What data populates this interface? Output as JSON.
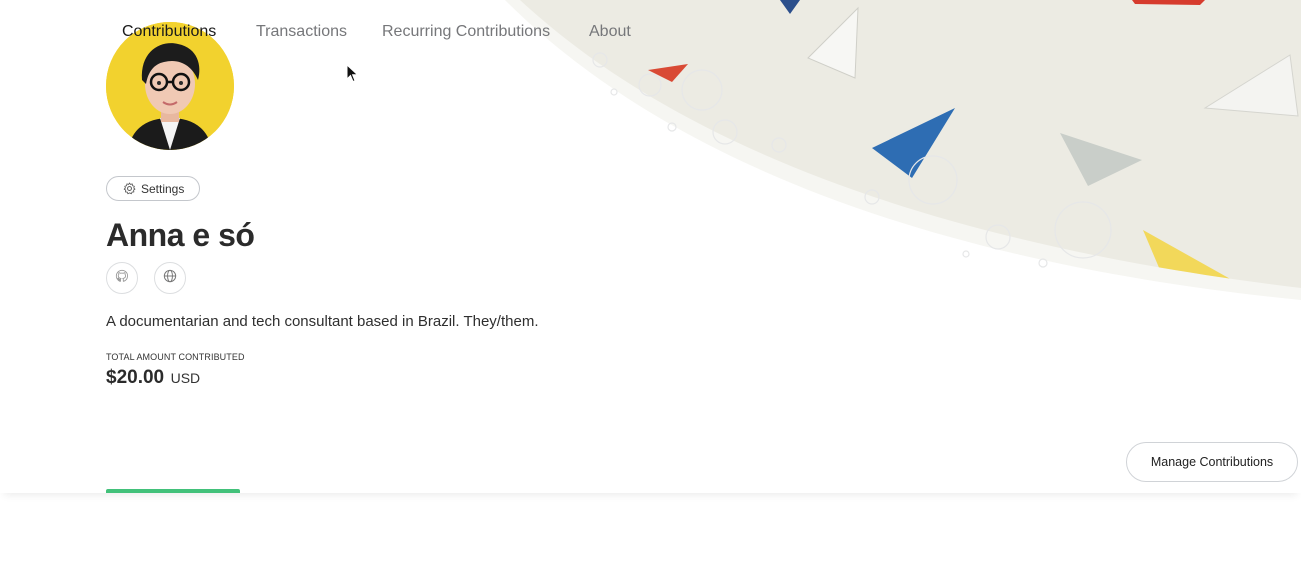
{
  "profile": {
    "name": "Anna e só",
    "bio": "A documentarian and tech consultant based in Brazil. They/them.",
    "settings_label": "Settings",
    "avatar_icon": "avatar-photo",
    "social_links": [
      {
        "icon": "github-icon"
      },
      {
        "icon": "globe-icon"
      }
    ]
  },
  "stats": {
    "total_label": "TOTAL AMOUNT CONTRIBUTED",
    "total_amount": "$20.00",
    "total_currency": "USD"
  },
  "tabs": [
    {
      "label": "Contributions",
      "active": true
    },
    {
      "label": "Transactions",
      "active": false
    },
    {
      "label": "Recurring Contributions",
      "active": false
    },
    {
      "label": "About",
      "active": false
    }
  ],
  "actions": {
    "manage_label": "Manage Contributions"
  },
  "colors": {
    "accent": "#42c17a",
    "text": "#2b2b2b",
    "muted": "#76777a",
    "avatar_bg": "#f2d22e"
  }
}
